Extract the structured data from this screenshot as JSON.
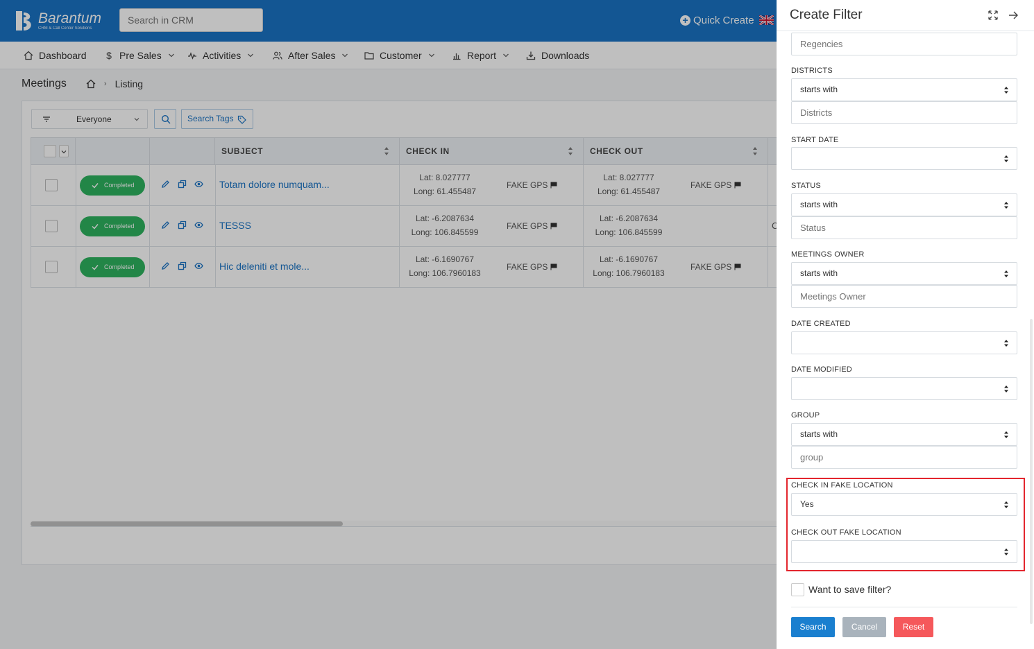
{
  "app": {
    "logo_title": "Barantum",
    "logo_subtitle": "CRM & Call Center Solutions",
    "search_placeholder": "Search in CRM",
    "quick_create": "Quick Create"
  },
  "nav": [
    {
      "label": "Dashboard"
    },
    {
      "label": "Pre Sales"
    },
    {
      "label": "Activities"
    },
    {
      "label": "After Sales"
    },
    {
      "label": "Customer"
    },
    {
      "label": "Report"
    },
    {
      "label": "Downloads"
    }
  ],
  "breadcrumb": {
    "title": "Meetings",
    "current": "Listing"
  },
  "toolbar": {
    "owner_filter": "Everyone",
    "search_tags": "Search Tags"
  },
  "table": {
    "columns": [
      "SUBJECT",
      "CHECK IN",
      "CHECK OUT"
    ],
    "rows": [
      {
        "status": "Completed",
        "subject": "Totam dolore numquam...",
        "in_lat": "Lat: 8.027777",
        "in_long": "Long: 61.455487",
        "in_fake": "FAKE GPS",
        "out_lat": "Lat: 8.027777",
        "out_long": "Long: 61.455487",
        "out_fake": "FAKE GPS",
        "extra": ""
      },
      {
        "status": "Completed",
        "subject": "TESSS",
        "in_lat": "Lat: -6.2087634",
        "in_long": "Long: 106.845599",
        "in_fake": "FAKE GPS",
        "out_lat": "Lat: -6.2087634",
        "out_long": "Long: 106.845599",
        "out_fake": "",
        "extra": "C"
      },
      {
        "status": "Completed",
        "subject": "Hic deleniti et mole...",
        "in_lat": "Lat: -6.1690767",
        "in_long": "Long: 106.7960183",
        "in_fake": "FAKE GPS",
        "out_lat": "Lat: -6.1690767",
        "out_long": "Long: 106.7960183",
        "out_fake": "FAKE GPS",
        "extra": ""
      }
    ]
  },
  "panel": {
    "title": "Create Filter",
    "regencies_placeholder": "Regencies",
    "districts_label": "DISTRICTS",
    "districts_op": "starts with",
    "districts_placeholder": "Districts",
    "start_date_label": "START DATE",
    "status_label": "STATUS",
    "status_op": "starts with",
    "status_placeholder": "Status",
    "owner_label": "MEETINGS OWNER",
    "owner_op": "starts with",
    "owner_placeholder": "Meetings Owner",
    "date_created_label": "DATE CREATED",
    "date_modified_label": "DATE MODIFIED",
    "group_label": "GROUP",
    "group_op": "starts with",
    "group_placeholder": "group",
    "checkin_fake_label": "CHECK IN FAKE LOCATION",
    "checkin_fake_value": "Yes",
    "checkout_fake_label": "CHECK OUT FAKE LOCATION",
    "save_filter_label": "Want to save filter?",
    "search_button": "Search",
    "cancel_button": "Cancel",
    "reset_button": "Reset"
  }
}
